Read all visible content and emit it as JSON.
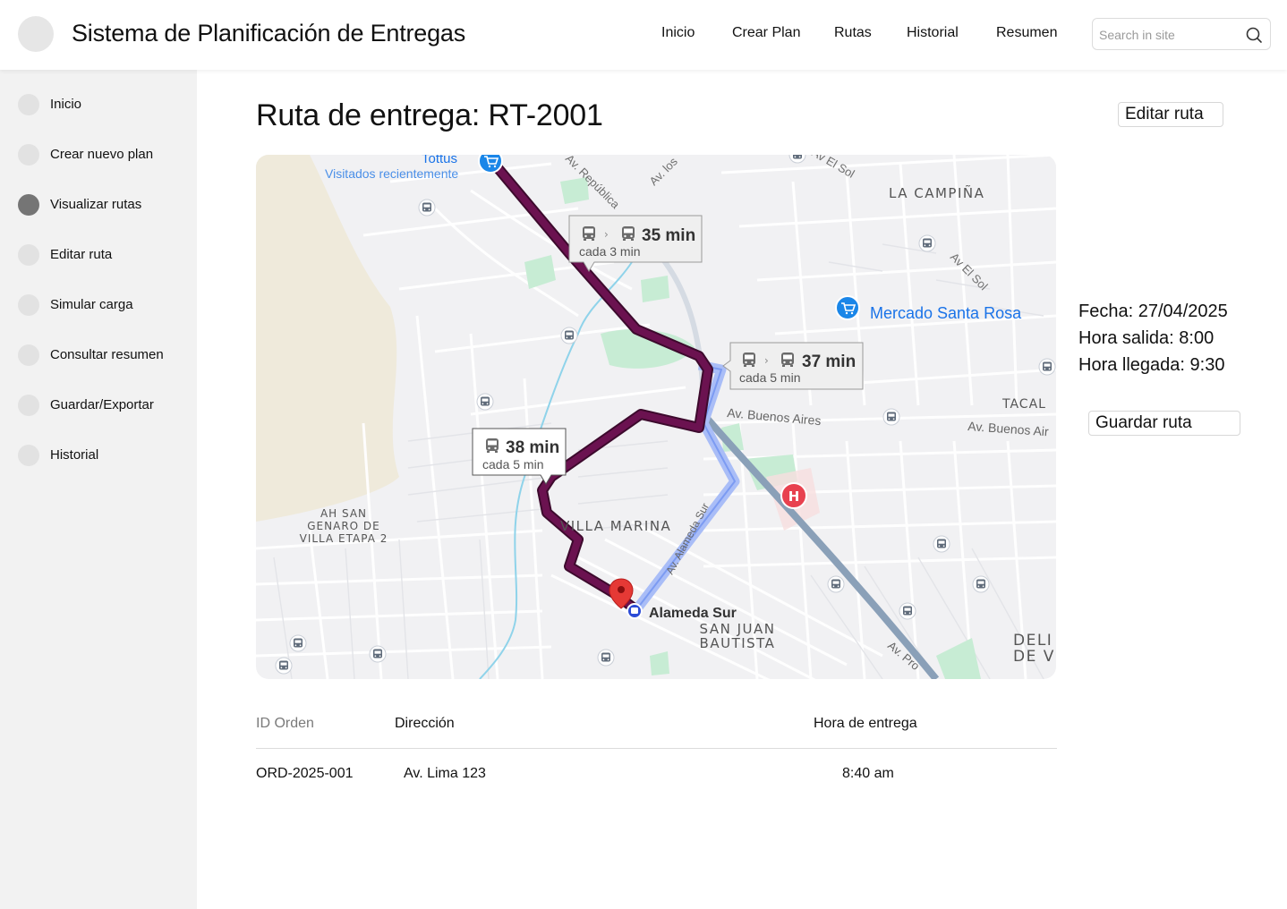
{
  "header": {
    "title": "Sistema de Planificación de Entregas",
    "nav": [
      "Inicio",
      "Crear Plan",
      "Rutas",
      "Historial",
      "Resumen"
    ],
    "search_placeholder": "Search in site"
  },
  "sidebar": {
    "items": [
      {
        "label": "Inicio",
        "active": false
      },
      {
        "label": "Crear nuevo plan",
        "active": false
      },
      {
        "label": "Visualizar rutas",
        "active": true
      },
      {
        "label": "Editar ruta",
        "active": false
      },
      {
        "label": "Simular carga",
        "active": false
      },
      {
        "label": "Consultar resumen",
        "active": false
      },
      {
        "label": "Guardar/Exportar",
        "active": false
      },
      {
        "label": "Historial",
        "active": false
      }
    ]
  },
  "main": {
    "title": "Ruta de entrega: RT-2001",
    "edit_button": "Editar ruta",
    "save_button": "Guardar ruta",
    "info": {
      "fecha": "Fecha: 27/04/2025",
      "hora_salida": "Hora salida: 8:00",
      "hora_llegada": "Hora llegada: 9:30"
    }
  },
  "map": {
    "labels": {
      "tottus": "Tottus",
      "visitados": "Visitados recientemente",
      "la_campina": "LA CAMPIÑA",
      "mercado": "Mercado Santa Rosa",
      "tacal": "TACAL",
      "av_buenos_aires": "Av. Buenos Aires",
      "av_buenos_aires_2": "Av. Buenos Air",
      "villa_marina": "VILLA MARINA",
      "ah_san_genaro_1": "AH SAN",
      "ah_san_genaro_2": "GENARO DE",
      "ah_san_genaro_3": "VILLA ETAPA 2",
      "alameda_sur": "Alameda Sur",
      "av_alameda_sur": "Av. Alameda Sur",
      "san_juan_1": "SAN JUAN",
      "san_juan_2": "BAUTISTA",
      "deli_1": "DELI",
      "deli_2": "DE V",
      "av_republica": "Av. República",
      "av_los": "Av. los",
      "av_el_sol_1": "Av El Sol",
      "av_el_sol_2": "Av El Sol",
      "av_pro": "Av. Pro"
    },
    "callouts": [
      {
        "time": "35 min",
        "freq": "cada 3 min"
      },
      {
        "time": "37 min",
        "freq": "cada 5 min"
      },
      {
        "time": "38 min",
        "freq": "cada 5 min"
      }
    ],
    "colors": {
      "route_primary": "#6b1250",
      "route_alt": "#a9bdf7",
      "road_main": "#8aa0b8",
      "park": "#c7ecd4",
      "desert": "#efeadb",
      "river": "#8fd3ea",
      "pin": "#e53935",
      "hospital": "#e8414f",
      "poi_blue": "#1a86e8"
    }
  },
  "table": {
    "headers": [
      "ID Orden",
      "Dirección",
      "Hora de entrega"
    ],
    "rows": [
      [
        "ORD-2025-001",
        "Av. Lima 123",
        "8:40 am"
      ]
    ]
  }
}
